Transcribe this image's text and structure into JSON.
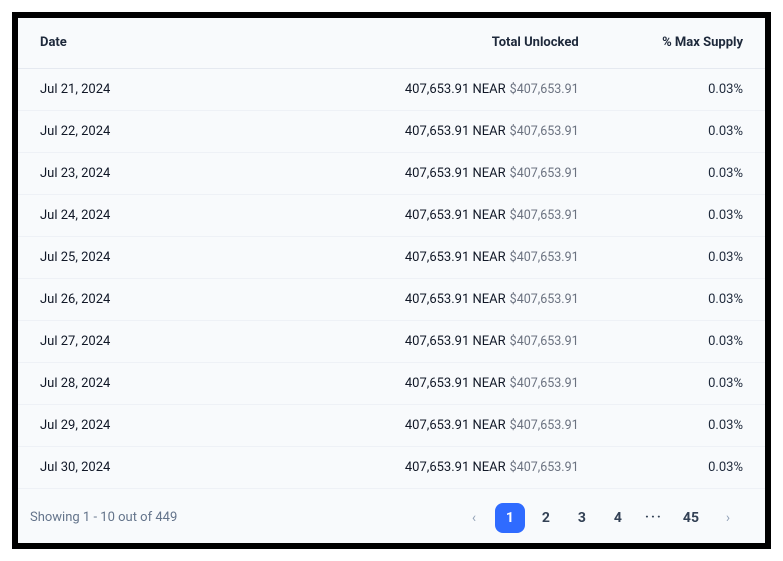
{
  "table": {
    "columns": {
      "date": "Date",
      "unlocked": "Total Unlocked",
      "pct": "% Max Supply"
    },
    "rows": [
      {
        "date": "Jul 21, 2024",
        "amount": "407,653.91 NEAR",
        "usd": "$407,653.91",
        "pct": "0.03%"
      },
      {
        "date": "Jul 22, 2024",
        "amount": "407,653.91 NEAR",
        "usd": "$407,653.91",
        "pct": "0.03%"
      },
      {
        "date": "Jul 23, 2024",
        "amount": "407,653.91 NEAR",
        "usd": "$407,653.91",
        "pct": "0.03%"
      },
      {
        "date": "Jul 24, 2024",
        "amount": "407,653.91 NEAR",
        "usd": "$407,653.91",
        "pct": "0.03%"
      },
      {
        "date": "Jul 25, 2024",
        "amount": "407,653.91 NEAR",
        "usd": "$407,653.91",
        "pct": "0.03%"
      },
      {
        "date": "Jul 26, 2024",
        "amount": "407,653.91 NEAR",
        "usd": "$407,653.91",
        "pct": "0.03%"
      },
      {
        "date": "Jul 27, 2024",
        "amount": "407,653.91 NEAR",
        "usd": "$407,653.91",
        "pct": "0.03%"
      },
      {
        "date": "Jul 28, 2024",
        "amount": "407,653.91 NEAR",
        "usd": "$407,653.91",
        "pct": "0.03%"
      },
      {
        "date": "Jul 29, 2024",
        "amount": "407,653.91 NEAR",
        "usd": "$407,653.91",
        "pct": "0.03%"
      },
      {
        "date": "Jul 30, 2024",
        "amount": "407,653.91 NEAR",
        "usd": "$407,653.91",
        "pct": "0.03%"
      }
    ]
  },
  "pagination": {
    "summary": "Showing 1 - 10 out of 449",
    "prev_glyph": "‹",
    "next_glyph": "›",
    "pages": [
      "1",
      "2",
      "3",
      "4"
    ],
    "ellipsis": "···",
    "last": "45",
    "active_index": 0
  }
}
